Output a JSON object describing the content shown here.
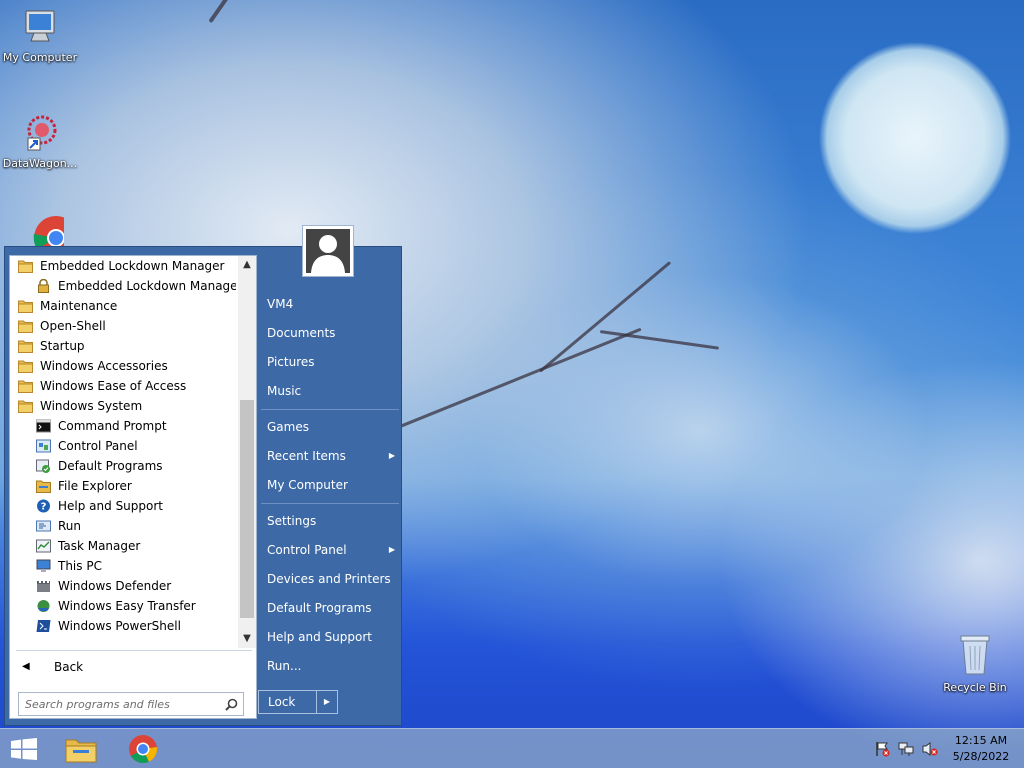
{
  "desktop": {
    "icons": [
      {
        "label": "My Computer",
        "icon": "my-computer-icon"
      },
      {
        "label": "DataWagon...",
        "icon": "datawagon-shortcut-icon"
      },
      {
        "label": "",
        "icon": "chrome-icon"
      },
      {
        "label": "Recycle Bin",
        "icon": "recycle-bin-icon"
      }
    ]
  },
  "start_menu": {
    "programs": [
      {
        "label": "Embedded Lockdown Manager",
        "icon": "folder-icon",
        "indent": 0
      },
      {
        "label": "Embedded Lockdown Manager",
        "icon": "lock-icon",
        "indent": 1
      },
      {
        "label": "Maintenance",
        "icon": "folder-icon",
        "indent": 0
      },
      {
        "label": "Open-Shell",
        "icon": "folder-icon",
        "indent": 0
      },
      {
        "label": "Startup",
        "icon": "folder-icon",
        "indent": 0
      },
      {
        "label": "Windows Accessories",
        "icon": "folder-icon",
        "indent": 0
      },
      {
        "label": "Windows Ease of Access",
        "icon": "folder-icon",
        "indent": 0
      },
      {
        "label": "Windows System",
        "icon": "folder-icon",
        "indent": 0
      },
      {
        "label": "Command Prompt",
        "icon": "command-prompt-icon",
        "indent": 1
      },
      {
        "label": "Control Panel",
        "icon": "control-panel-icon",
        "indent": 1
      },
      {
        "label": "Default Programs",
        "icon": "default-programs-icon",
        "indent": 1
      },
      {
        "label": "File Explorer",
        "icon": "file-explorer-icon",
        "indent": 1
      },
      {
        "label": "Help and Support",
        "icon": "help-icon",
        "indent": 1
      },
      {
        "label": "Run",
        "icon": "run-icon",
        "indent": 1
      },
      {
        "label": "Task Manager",
        "icon": "task-manager-icon",
        "indent": 1
      },
      {
        "label": "This PC",
        "icon": "this-pc-icon",
        "indent": 1
      },
      {
        "label": "Windows Defender",
        "icon": "windows-defender-icon",
        "indent": 1
      },
      {
        "label": "Windows Easy Transfer",
        "icon": "easy-transfer-icon",
        "indent": 1
      },
      {
        "label": "Windows PowerShell",
        "icon": "powershell-icon",
        "indent": 1
      }
    ],
    "back_label": "Back",
    "search_placeholder": "Search programs and files",
    "right_items": [
      {
        "label": "VM4",
        "has_submenu": false
      },
      {
        "label": "Documents",
        "has_submenu": false
      },
      {
        "label": "Pictures",
        "has_submenu": false
      },
      {
        "label": "Music",
        "has_submenu": false
      },
      {
        "label": "Games",
        "has_submenu": false
      },
      {
        "label": "Recent Items",
        "has_submenu": true
      },
      {
        "label": "My Computer",
        "has_submenu": false
      },
      {
        "label": "Settings",
        "has_submenu": false
      },
      {
        "label": "Control Panel",
        "has_submenu": true
      },
      {
        "label": "Devices and Printers",
        "has_submenu": false
      },
      {
        "label": "Default Programs",
        "has_submenu": false
      },
      {
        "label": "Help and Support",
        "has_submenu": false
      },
      {
        "label": "Run...",
        "has_submenu": false
      }
    ],
    "lock_label": "Lock"
  },
  "taskbar": {
    "pinned": [
      {
        "name": "file-explorer",
        "icon": "folder-icon"
      },
      {
        "name": "chrome",
        "icon": "chrome-icon"
      }
    ],
    "tray_icons": [
      "action-center-flag-icon",
      "network-icon",
      "volume-muted-icon"
    ],
    "time": "12:15 AM",
    "date": "5/28/2022"
  },
  "colors": {
    "menu_blue": "#3d6aa6",
    "folder_yellow": "#e6b94a",
    "taskbar": "#9cb3cb"
  }
}
